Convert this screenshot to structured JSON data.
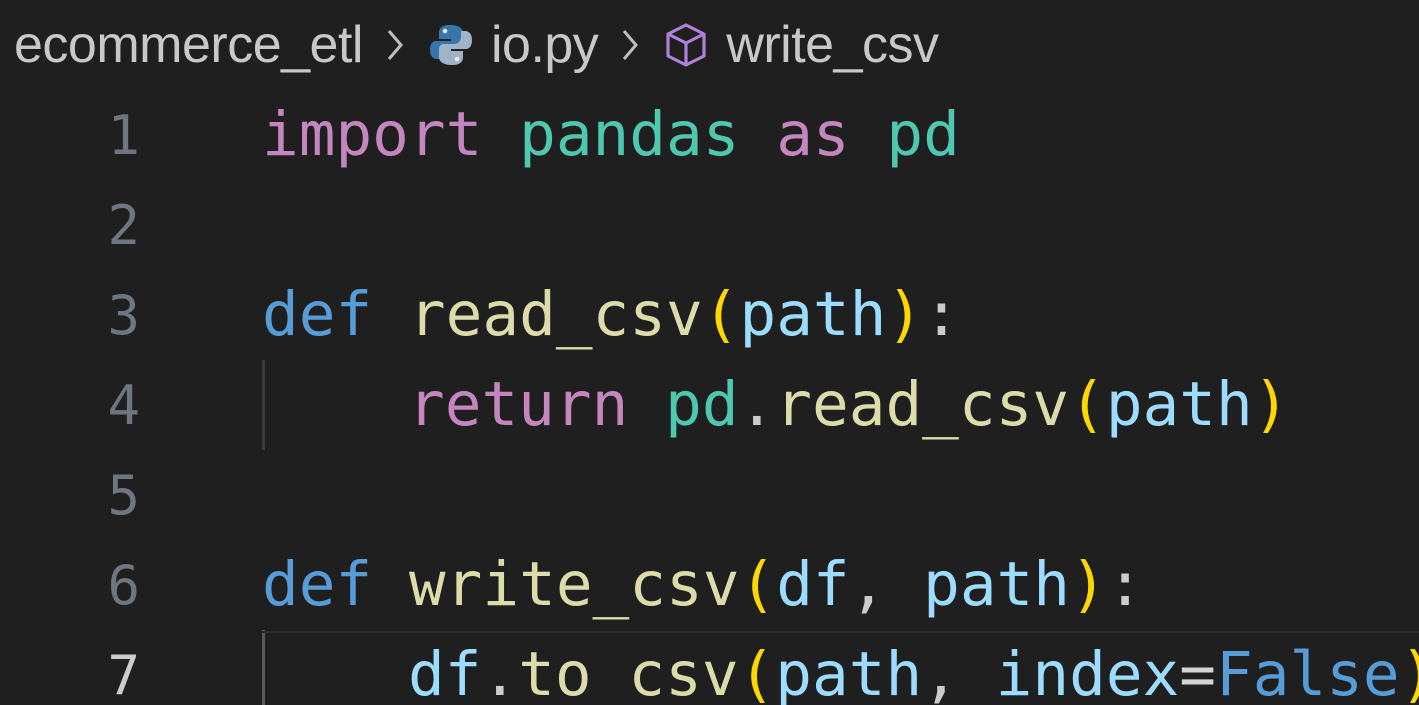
{
  "breadcrumb": {
    "folder": "ecommerce_etl",
    "file": "io.py",
    "symbol": "write_csv"
  },
  "icons": {
    "separator": "chevron-right-icon",
    "file": "python-icon",
    "symbol": "cube-method-icon"
  },
  "colors": {
    "background": "#1f1f1f",
    "keyword_purple": "#c586c0",
    "keyword_blue": "#569cd6",
    "module_teal": "#4ec9b0",
    "function_yellow": "#dcdcaa",
    "variable_blue": "#9cdcfe",
    "bracket_gold": "#ffd700",
    "bracket_violet": "#da70d6"
  },
  "editor": {
    "active_line": 7,
    "lines": [
      {
        "number": "1",
        "tokens": {
          "t1": "import",
          "t2": " ",
          "t3": "pandas",
          "t4": " ",
          "t5": "as",
          "t6": " ",
          "t7": "pd"
        }
      },
      {
        "number": "2"
      },
      {
        "number": "3",
        "tokens": {
          "t1": "def",
          "t2": " ",
          "t3": "read_csv",
          "t4": "(",
          "t5": "path",
          "t6": ")",
          "t7": ":"
        }
      },
      {
        "number": "4",
        "tokens": {
          "t1": "return",
          "t2": " ",
          "t3": "pd",
          "t4": ".",
          "t5": "read_csv",
          "t6": "(",
          "t7": "path",
          "t8": ")"
        }
      },
      {
        "number": "5"
      },
      {
        "number": "6",
        "tokens": {
          "t1": "def",
          "t2": " ",
          "t3": "write_csv",
          "t4": "(",
          "t5": "df",
          "t6": ", ",
          "t7": "path",
          "t8": ")",
          "t9": ":"
        }
      },
      {
        "number": "7",
        "tokens": {
          "t1": "df",
          "t2": ".",
          "t3": "to_csv",
          "t4": "(",
          "t5": "path",
          "t6": ", ",
          "t7": "index",
          "t8": "=",
          "t9": "False",
          "t10": ")"
        }
      }
    ]
  }
}
